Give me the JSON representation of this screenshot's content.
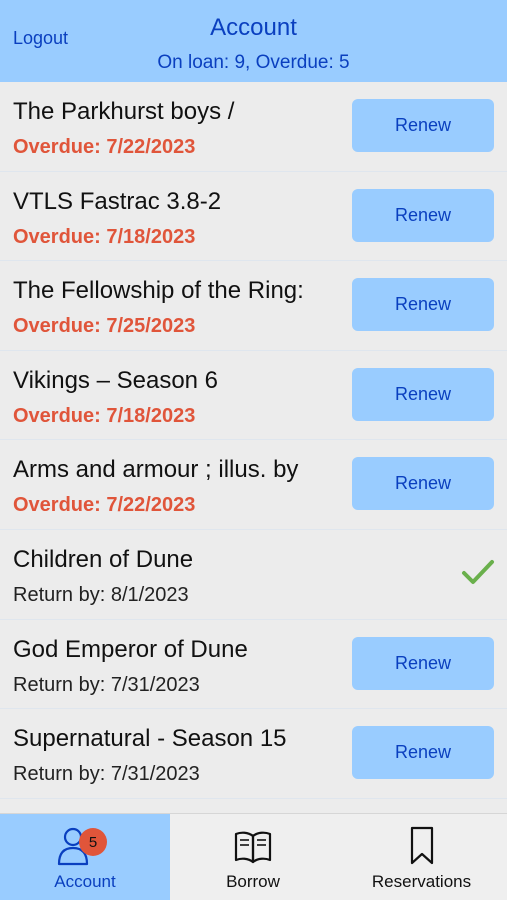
{
  "header": {
    "logout_label": "Logout",
    "title": "Account",
    "stats": "On loan: 9, Overdue: 5"
  },
  "items": [
    {
      "title": "The Parkhurst boys /",
      "due": "Overdue: 7/22/2023",
      "overdue": true,
      "action": "Renew"
    },
    {
      "title": "VTLS Fastrac 3.8-2",
      "due": "Overdue: 7/18/2023",
      "overdue": true,
      "action": "Renew"
    },
    {
      "title": "The Fellowship of the Ring:",
      "due": "Overdue: 7/25/2023",
      "overdue": true,
      "action": "Renew"
    },
    {
      "title": "Vikings – Season 6",
      "due": "Overdue: 7/18/2023",
      "overdue": true,
      "action": "Renew"
    },
    {
      "title": "Arms and armour ; illus. by",
      "due": "Overdue: 7/22/2023",
      "overdue": true,
      "action": "Renew"
    },
    {
      "title": "Children of Dune",
      "due": "Return by: 8/1/2023",
      "overdue": false,
      "action": "check-icon"
    },
    {
      "title": "God Emperor of Dune",
      "due": "Return by: 7/31/2023",
      "overdue": false,
      "action": "Renew"
    },
    {
      "title": "Supernatural - Season 15",
      "due": "Return by: 7/31/2023",
      "overdue": false,
      "action": "Renew"
    }
  ],
  "tabs": [
    {
      "label": "Account",
      "icon": "person-icon",
      "badge": "5",
      "active": true
    },
    {
      "label": "Borrow",
      "icon": "book-icon",
      "active": false
    },
    {
      "label": "Reservations",
      "icon": "bookmark-icon",
      "active": false
    }
  ],
  "colors": {
    "accent": "#99ccff",
    "link": "#0a3fbf",
    "overdue": "#e0553a",
    "check": "#6ab04c",
    "background": "#ececec"
  }
}
